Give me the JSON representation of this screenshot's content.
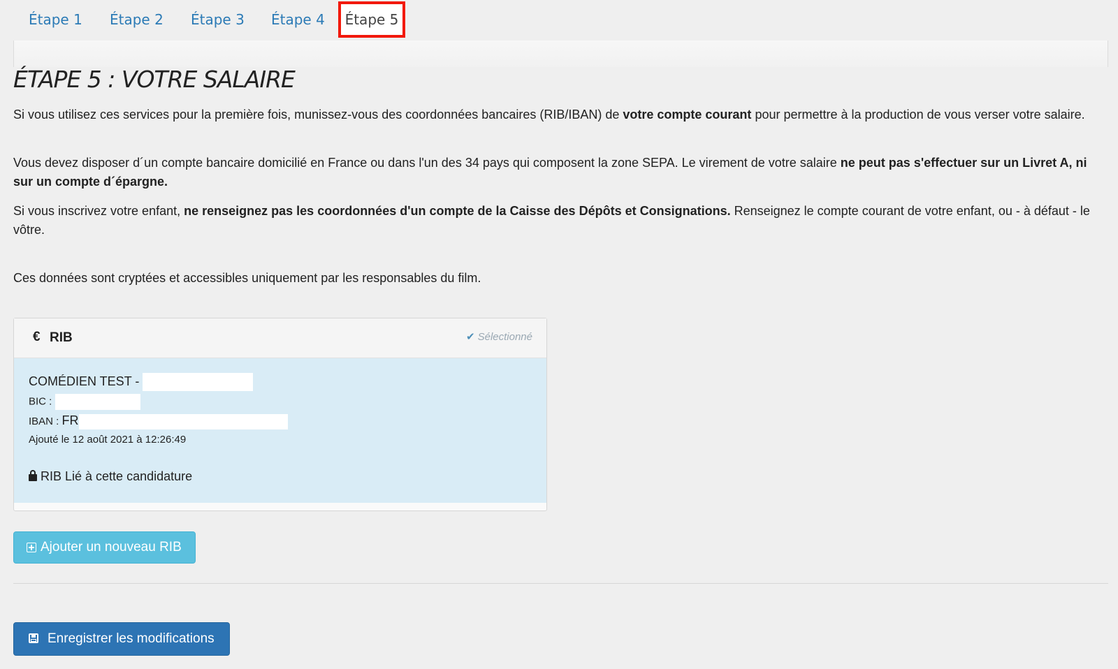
{
  "tabs": [
    {
      "label": "Étape 1"
    },
    {
      "label": "Étape 2"
    },
    {
      "label": "Étape 3"
    },
    {
      "label": "Étape 4"
    },
    {
      "label": "Étape 5"
    }
  ],
  "page_title": "ÉTAPE 5 : VOTRE SALAIRE",
  "paragraphs": {
    "p1_a": "Si vous utilisez ces services pour la première fois, munissez-vous des coordonnées bancaires (RIB/IBAN) de ",
    "p1_b": "votre compte courant",
    "p1_c": " pour permettre à la production de vous verser votre salaire.",
    "p2_a": "Vous devez disposer d´un compte bancaire domicilié en France ou dans l'un des 34 pays qui composent la zone SEPA. Le virement de votre salaire ",
    "p2_b": "ne peut pas s'effectuer sur un Livret A, ni sur un compte d´épargne.",
    "p3_a": "Si vous inscrivez votre enfant, ",
    "p3_b": "ne renseignez pas les coordonnées d'un compte de la Caisse des Dépôts et Consignations.",
    "p3_c": " Renseignez le compte courant de votre enfant, ou - à défaut - le vôtre.",
    "p4": "Ces données sont cryptées et accessibles uniquement par les responsables du film."
  },
  "rib_card": {
    "currency_icon": "€",
    "title": "RIB",
    "status_icon": "check-icon",
    "status_label": "Sélectionné",
    "holder": "COMÉDIEN TEST - ",
    "bic_label": "BIC : ",
    "iban_label": "IBAN : ",
    "iban_prefix": "FR",
    "added": "Ajouté le 12 août 2021 à 12:26:49",
    "lock_icon": "lock-icon",
    "linked_label": "RIB Lié à cette candidature"
  },
  "buttons": {
    "add_rib": "Ajouter un nouveau RIB",
    "save": "Enregistrer les modifications"
  },
  "colors": {
    "tab_link": "#2c7bb6",
    "active_tab_highlight": "#f2190b",
    "rib_body_bg": "#d9ecf6",
    "btn_info": "#5bc0de",
    "btn_primary": "#2d74b4"
  }
}
